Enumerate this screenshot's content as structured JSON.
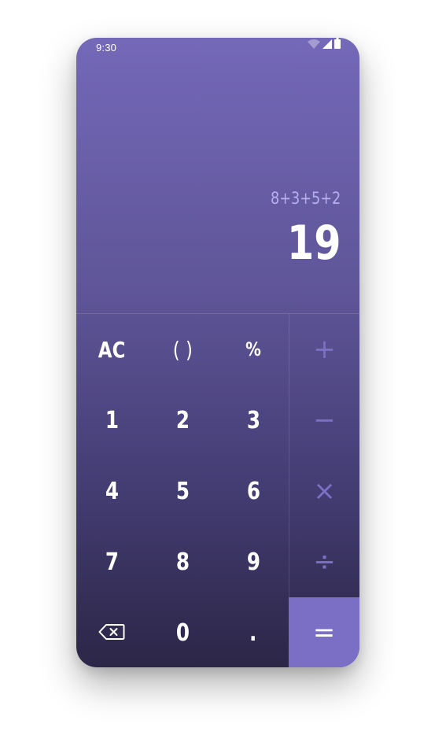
{
  "status_bar": {
    "time": "9:30",
    "icons": [
      "wifi-icon",
      "cellular-signal-icon",
      "battery-icon"
    ]
  },
  "display": {
    "expression": "8+3+5+2",
    "result": "19"
  },
  "keypad": {
    "row1": [
      "AC",
      "( )",
      "%"
    ],
    "row2": [
      "1",
      "2",
      "3"
    ],
    "row3": [
      "4",
      "5",
      "6"
    ],
    "row4": [
      "7",
      "8",
      "9"
    ],
    "row5": [
      "0",
      "."
    ],
    "backspace_icon": "backspace-icon"
  },
  "operators": {
    "plus": "+",
    "minus": "−",
    "multiply": "×",
    "divide": "÷",
    "equals": "="
  },
  "colors": {
    "gradient_top": "#7468b8",
    "gradient_bottom": "#2c2647",
    "accent": "#7a6fc5",
    "operator_text": "#7c70c4",
    "expression_text": "#b9aef0"
  }
}
